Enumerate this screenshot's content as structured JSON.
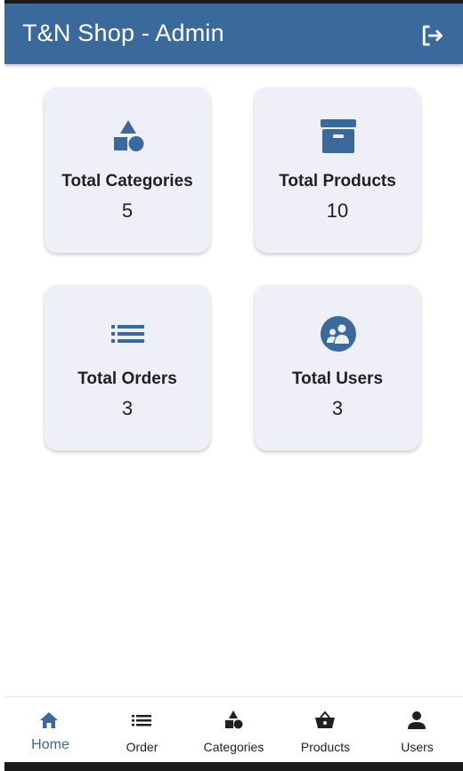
{
  "app": {
    "title": "T&N Shop - Admin",
    "accent_color": "#3a6a9c",
    "logout_icon": "logout-icon"
  },
  "dashboard": {
    "cards": [
      {
        "label": "Total Categories",
        "value": "5",
        "icon": "shapes-icon"
      },
      {
        "label": "Total Products",
        "value": "10",
        "icon": "archive-box-icon"
      },
      {
        "label": "Total Orders",
        "value": "3",
        "icon": "list-icon"
      },
      {
        "label": "Total Users",
        "value": "3",
        "icon": "users-group-icon"
      }
    ]
  },
  "bottom_nav": {
    "items": [
      {
        "label": "Home",
        "icon": "home-icon",
        "active": true
      },
      {
        "label": "Order",
        "icon": "list-icon",
        "active": false
      },
      {
        "label": "Categories",
        "icon": "shapes-icon",
        "active": false
      },
      {
        "label": "Products",
        "icon": "basket-icon",
        "active": false
      },
      {
        "label": "Users",
        "icon": "person-icon",
        "active": false
      }
    ]
  }
}
